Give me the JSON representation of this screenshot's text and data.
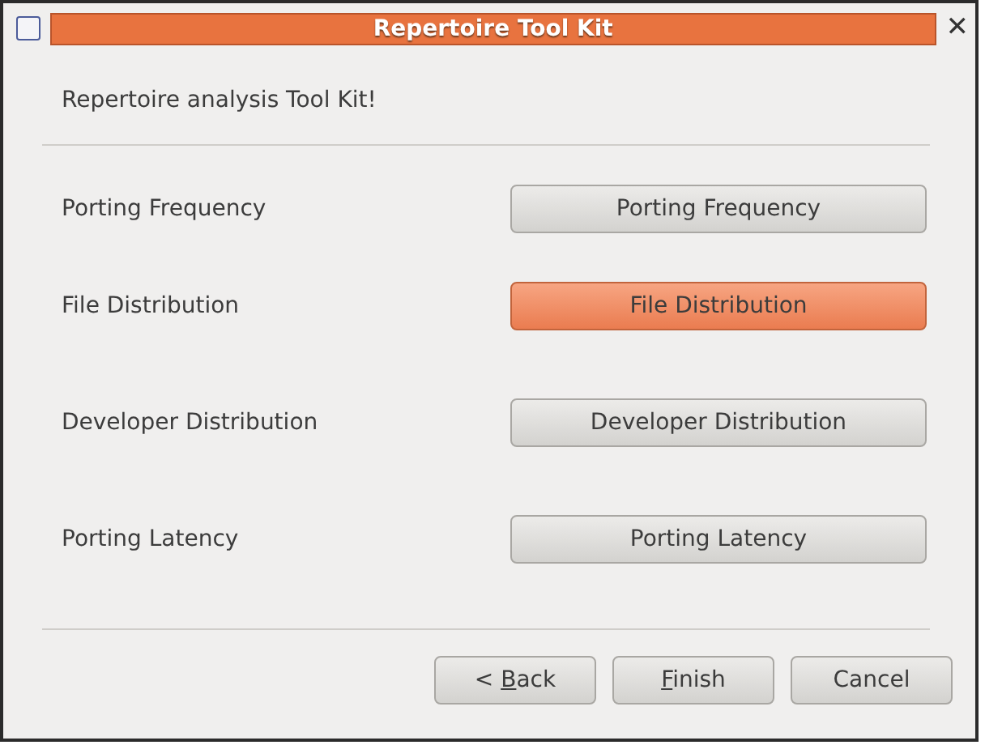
{
  "window": {
    "title": "Repertoire Tool Kit",
    "close": "✕",
    "checked": false
  },
  "heading": "Repertoire analysis Tool Kit!",
  "rows": [
    {
      "label": "Porting Frequency",
      "button": "Porting Frequency",
      "highlighted": false
    },
    {
      "label": "File Distribution",
      "button": "File Distribution",
      "highlighted": true
    },
    {
      "label": "Developer Distribution",
      "button": "Developer Distribution",
      "highlighted": false
    },
    {
      "label": "Porting Latency",
      "button": "Porting Latency",
      "highlighted": false
    }
  ],
  "buttons": [
    {
      "prefix": "< ",
      "label": "Back",
      "mnemonic": true
    },
    {
      "label": "Finish",
      "mnemonic": true
    },
    {
      "label": "Cancel",
      "mnemonic": false
    }
  ]
}
